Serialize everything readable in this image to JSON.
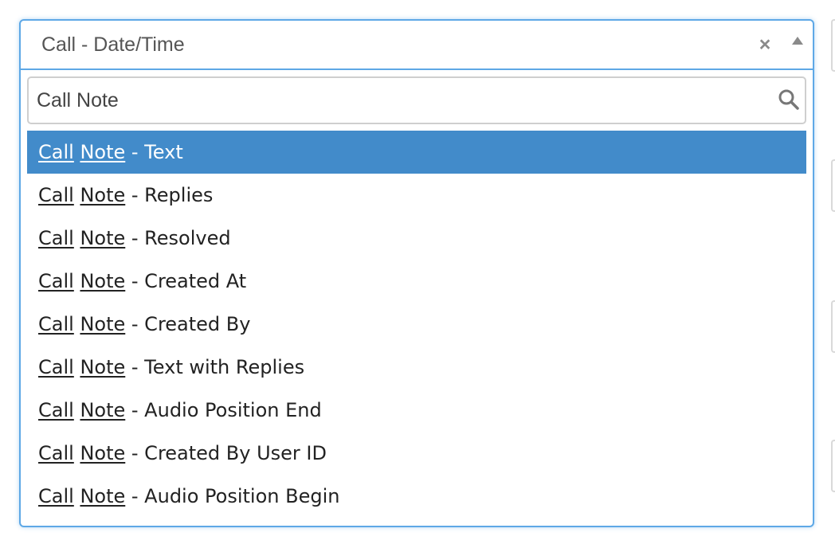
{
  "select": {
    "selected_value": "Call - Date/Time",
    "clear_symbol": "×",
    "search": {
      "value": "Call Note",
      "placeholder": ""
    },
    "results": [
      {
        "match1": "Call",
        "match2": "Note",
        "rest": " - Text",
        "highlighted": true
      },
      {
        "match1": "Call",
        "match2": "Note",
        "rest": " - Replies",
        "highlighted": false
      },
      {
        "match1": "Call",
        "match2": "Note",
        "rest": " - Resolved",
        "highlighted": false
      },
      {
        "match1": "Call",
        "match2": "Note",
        "rest": " - Created At",
        "highlighted": false
      },
      {
        "match1": "Call",
        "match2": "Note",
        "rest": " - Created By",
        "highlighted": false
      },
      {
        "match1": "Call",
        "match2": "Note",
        "rest": " - Text with Replies",
        "highlighted": false
      },
      {
        "match1": "Call",
        "match2": "Note",
        "rest": " - Audio Position End",
        "highlighted": false
      },
      {
        "match1": "Call",
        "match2": "Note",
        "rest": " - Created By User ID",
        "highlighted": false
      },
      {
        "match1": "Call",
        "match2": "Note",
        "rest": " - Audio Position Begin",
        "highlighted": false
      }
    ]
  },
  "icons": {
    "clear": "close-icon",
    "arrow": "caret-up-icon",
    "search": "search-icon"
  },
  "colors": {
    "focus_border": "#5ea8e6",
    "highlight_bg": "#428bca",
    "highlight_text": "#ffffff"
  }
}
